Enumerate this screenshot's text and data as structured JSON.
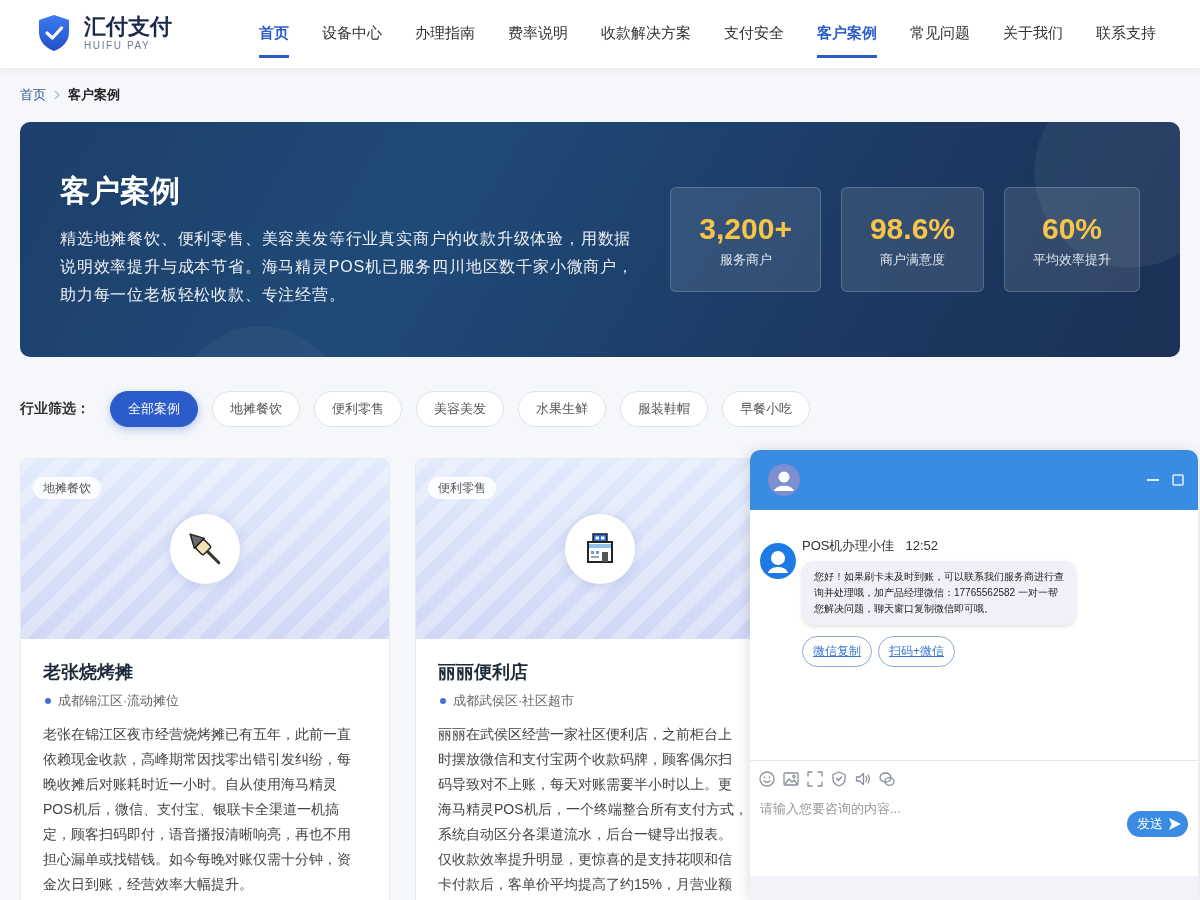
{
  "header": {
    "logo": {
      "title": "汇付支付",
      "subtitle": "HUIFU PAY"
    },
    "nav": [
      {
        "label": "首页",
        "selected": true
      },
      {
        "label": "设备中心",
        "selected": false
      },
      {
        "label": "办理指南",
        "selected": false
      },
      {
        "label": "费率说明",
        "selected": false
      },
      {
        "label": "收款解决方案",
        "selected": false
      },
      {
        "label": "支付安全",
        "selected": false
      },
      {
        "label": "客户案例",
        "selected": true
      },
      {
        "label": "常见问题",
        "selected": false
      },
      {
        "label": "关于我们",
        "selected": false
      },
      {
        "label": "联系支持",
        "selected": false
      }
    ]
  },
  "breadcrumb": [
    {
      "label": "首页",
      "current": false
    },
    {
      "label": "客户案例",
      "current": true
    }
  ],
  "hero": {
    "title": "客户案例",
    "description": "精选地摊餐饮、便利零售、美容美发等行业真实商户的收款升级体验，用数据说明效率提升与成本节省。海马精灵POS机已服务四川地区数千家小微商户，助力每一位老板轻松收款、专注经营。",
    "stats": [
      {
        "value": "3,200+",
        "label": "服务商户"
      },
      {
        "value": "98.6%",
        "label": "商户满意度"
      },
      {
        "value": "60%",
        "label": "平均效率提升"
      }
    ]
  },
  "filter": {
    "label": "行业筛选：",
    "options": [
      {
        "label": "全部案例",
        "selected": true
      },
      {
        "label": "地摊餐饮",
        "selected": false
      },
      {
        "label": "便利零售",
        "selected": false
      },
      {
        "label": "美容美发",
        "selected": false
      },
      {
        "label": "水果生鲜",
        "selected": false
      },
      {
        "label": "服装鞋帽",
        "selected": false
      },
      {
        "label": "早餐小吃",
        "selected": false
      }
    ]
  },
  "cases": [
    {
      "tag": "地摊餐饮",
      "title": "老张烧烤摊",
      "location": "成都锦江区·流动摊位",
      "description_lines": [
        "老张在锦江区夜市经营烧烤摊已有五年，此前一直",
        "依赖现金收款，高峰期常因找零出错引发纠纷，每",
        "晚收摊后对账耗时近一小时。自从使用海马精灵",
        "POS机后，微信、支付宝、银联卡全渠道一机搞",
        "定，顾客扫码即付，语音播报清晰响亮，再也不用",
        "担心漏单或找错钱。如今每晚对账仅需十分钟，资",
        "金次日到账，经营效率大幅提升。"
      ]
    },
    {
      "tag": "便利零售",
      "title": "丽丽便利店",
      "location": "成都武侯区·社区超市",
      "description_lines": [
        "丽丽在武侯区经营一家社区便利店，之前柜台上",
        "时摆放微信和支付宝两个收款码牌，顾客偶尔扫",
        "码导致对不上账，每天对账需要半小时以上。更",
        "海马精灵POS机后，一个终端整合所有支付方式，",
        "系统自动区分各渠道流水，后台一键导出报表。",
        "仅收款效率提升明显，更惊喜的是支持花呗和信",
        "卡付款后，客单价平均提高了约15%，月营业额"
      ]
    }
  ],
  "chat": {
    "messages": [
      {
        "sender": "POS机办理小佳",
        "time": "12:52",
        "text": "您好！如果刷卡未及时到账，可以联系我们服务商进行查询并处理哦，加产品经理微信：17765562582 一对一帮您解决问题，聊天窗口复制微信即可哦。",
        "quick_replies": [
          "微信复制",
          "扫码+微信"
        ]
      }
    ],
    "input": {
      "placeholder": "请输入您要咨询的内容..."
    },
    "send_button": "发送"
  }
}
